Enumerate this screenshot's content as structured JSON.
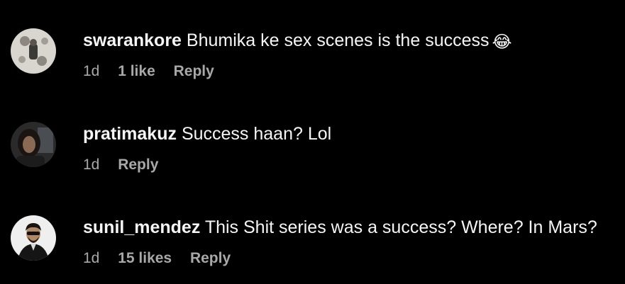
{
  "comments": [
    {
      "username": "swarankore",
      "text": "Bhumika ke sex scenes is the success",
      "emoji": "😂",
      "time": "1d",
      "likes": "1 like",
      "reply": "Reply"
    },
    {
      "username": "pratimakuz",
      "text": "Success haan? Lol",
      "time": "1d",
      "reply": "Reply"
    },
    {
      "username": "sunil_mendez",
      "text": "This Shit series was a success? Where? In Mars?",
      "time": "1d",
      "likes": "15 likes",
      "reply": "Reply"
    }
  ],
  "colors": {
    "background": "#000000",
    "primary_text": "#f5f5f5",
    "secondary_text": "#a8a8a8"
  }
}
